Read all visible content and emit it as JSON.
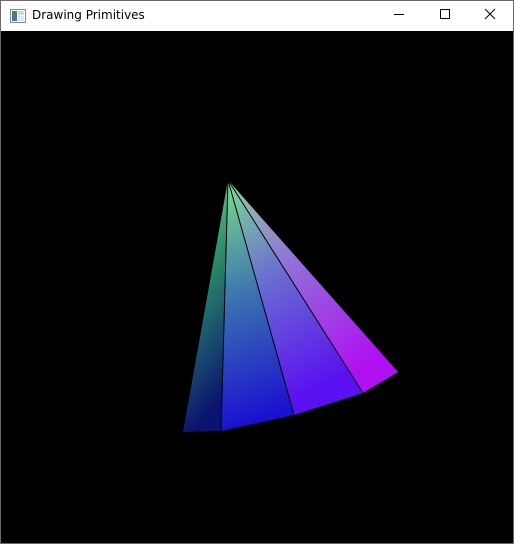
{
  "window": {
    "title": "Drawing Primitives",
    "app_icon": "window-app-icon",
    "controls": {
      "minimize_icon": "minimize-icon",
      "maximize_icon": "maximize-icon",
      "close_icon": "close-icon"
    }
  },
  "colors": {
    "background": "#000000",
    "titlebar": "#ffffff",
    "apex": "#7fdf8f",
    "base_left": "#0a1470",
    "base_mid": "#1a10e0",
    "base_right": "#e010f0",
    "edge_lines": "#000000"
  }
}
